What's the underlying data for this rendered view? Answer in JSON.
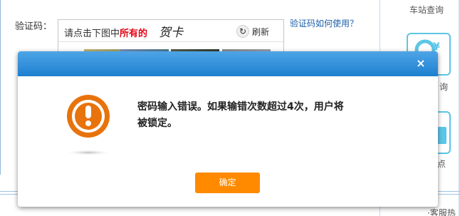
{
  "page": {
    "captcha_label": "验证码：",
    "captcha_instruction_prefix": "请点击下图中",
    "captcha_instruction_highlight": "所有的",
    "captcha_word": "贺卡",
    "refresh_label": "刷新",
    "help_link": "验证码如何使用？",
    "sidebar_station_query": "车站查询",
    "sidebar_fragment_1": "询",
    "sidebar_fragment_2": "售点",
    "bottom_fragment": "·客服热线"
  },
  "dialog": {
    "close_glyph": "×",
    "message_line1": "密码输入错误。如果输错次数超过4次，用户将",
    "message_line2": "被锁定。",
    "ok_label": "确定",
    "colors": {
      "header_top": "#4ea5e6",
      "header_bottom": "#1e7fd0",
      "button": "#ff8a00",
      "warning": "#e8730c"
    }
  }
}
